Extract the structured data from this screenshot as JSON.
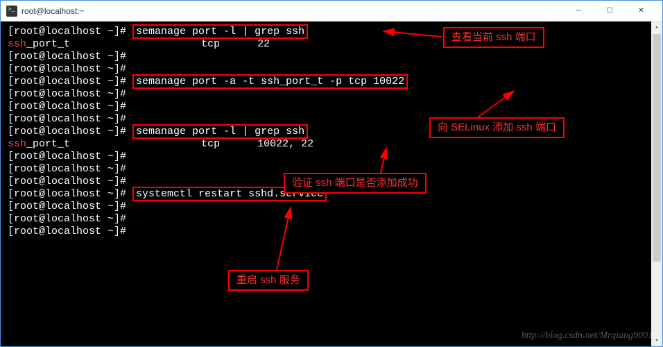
{
  "window": {
    "title": "root@localhost:~"
  },
  "prompt": "[root@localhost ~]#",
  "commands": {
    "cmd1": "semanage port -l | grep ssh",
    "cmd2": "semanage port -a -t ssh_port_t -p tcp 10022",
    "cmd3": "semanage port -l | grep ssh",
    "cmd4": "systemctl restart sshd.service"
  },
  "output": {
    "ssh_label": "ssh",
    "port_t": "_port_t",
    "proto": "tcp",
    "ports1": "22",
    "ports2": "10022, 22"
  },
  "annotations": {
    "a1": "查看当前 ssh 端口",
    "a2": "向 SELinux 添加 ssh 端口",
    "a3": "验证 ssh 端口是否添加成功",
    "a4": "重启 ssh 服务"
  },
  "watermark": "http://blog.csdn.net/Mrqiang9001"
}
